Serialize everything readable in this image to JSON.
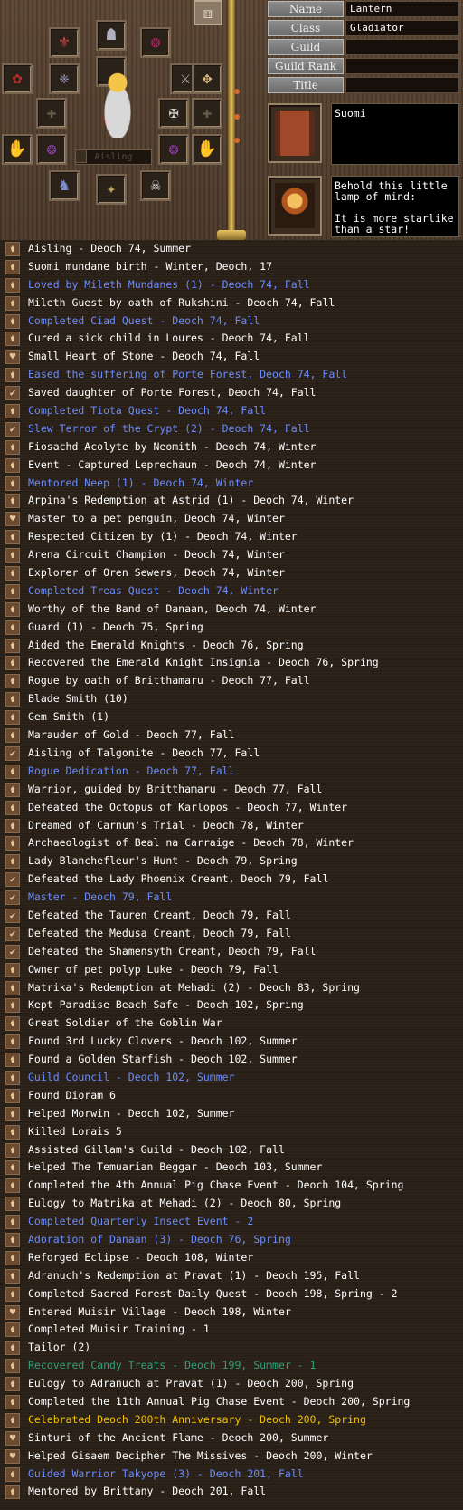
{
  "profile": {
    "fields": [
      {
        "label": "Name",
        "value": "Lantern"
      },
      {
        "label": "Class",
        "value": "Gladiator"
      },
      {
        "label": "Guild",
        "value": ""
      },
      {
        "label": "Guild Rank",
        "value": ""
      },
      {
        "label": "Title",
        "value": ""
      }
    ],
    "name_tag": "Aisling",
    "legend_item_1": {
      "text": "Suomi"
    },
    "legend_item_2": {
      "text": "Behold this little\nlamp of mind:\n\nIt is more starlike\nthan a star!"
    }
  },
  "equipment_slots": [
    {
      "name": "amulet-slot",
      "icon": "pendant-icon",
      "glyph": "⚜"
    },
    {
      "name": "helmet-slot",
      "icon": "helmet-icon",
      "glyph": "☗"
    },
    {
      "name": "ring-left-slot",
      "icon": "ring-icon",
      "glyph": "❂"
    },
    {
      "name": "rose-slot",
      "icon": "rose-icon",
      "glyph": "✿"
    },
    {
      "name": "wings-left-slot",
      "icon": "wings-icon",
      "glyph": "❈"
    },
    {
      "name": "weapon-slot",
      "icon": "sword-icon",
      "glyph": "⚔"
    },
    {
      "name": "angel-slot",
      "icon": "angel-icon",
      "glyph": "✥"
    },
    {
      "name": "empty-slot-1",
      "icon": "cross-icon",
      "glyph": "✚"
    },
    {
      "name": "armor-slot",
      "icon": "armor-icon",
      "glyph": "✠"
    },
    {
      "name": "empty-slot-2",
      "icon": "cross-icon",
      "glyph": "✚"
    },
    {
      "name": "gauntlet-left-slot",
      "icon": "gauntlet-icon",
      "glyph": "✋"
    },
    {
      "name": "earring-left-slot",
      "icon": "earring-icon",
      "glyph": "❂"
    },
    {
      "name": "earring-right-slot",
      "icon": "earring-icon",
      "glyph": "❂"
    },
    {
      "name": "gauntlet-right-slot",
      "icon": "gauntlet-icon",
      "glyph": "✋"
    },
    {
      "name": "boots-slot",
      "icon": "boots-icon",
      "glyph": "♞"
    },
    {
      "name": "belt-slot",
      "icon": "belt-icon",
      "glyph": "✦"
    },
    {
      "name": "accessory-slot",
      "icon": "skull-staff-icon",
      "glyph": "☠"
    },
    {
      "name": "shield-slot",
      "icon": "empty-icon",
      "glyph": ""
    }
  ],
  "top_right_button": {
    "icon": "dice-icon",
    "glyph": "⚃"
  },
  "colors": {
    "white": "#ffffff",
    "blue": "#6a8cff",
    "green": "#2fa07a",
    "yellow": "#f0c000"
  },
  "legend": [
    {
      "text": "Aisling - Deoch 74, Summer",
      "color": "white",
      "mark": "lantern-mark-icon"
    },
    {
      "text": "Suomi mundane birth - Winter, Deoch, 17",
      "color": "white",
      "mark": "lantern-mark-icon"
    },
    {
      "text": "Loved by Mileth Mundanes (1) - Deoch 74, Fall",
      "color": "blue",
      "mark": "lantern-mark-icon"
    },
    {
      "text": "Mileth Guest by oath of Rukshini - Deoch 74, Fall",
      "color": "white",
      "mark": "lantern-mark-icon"
    },
    {
      "text": "Completed Ciad Quest - Deoch 74, Fall",
      "color": "blue",
      "mark": "lantern-mark-icon"
    },
    {
      "text": "Cured a sick child in Loures - Deoch 74, Fall",
      "color": "white",
      "mark": "lantern-mark-icon"
    },
    {
      "text": "Small Heart of Stone - Deoch 74, Fall",
      "color": "white",
      "mark": "heart-mark-icon"
    },
    {
      "text": "Eased the suffering of Porte Forest, Deoch 74, Fall",
      "color": "blue",
      "mark": "lantern-mark-icon"
    },
    {
      "text": "Saved daughter of Porte Forest, Deoch 74, Fall",
      "color": "white",
      "mark": "check-mark-icon"
    },
    {
      "text": "Completed Tiota Quest - Deoch 74, Fall",
      "color": "blue",
      "mark": "lantern-mark-icon"
    },
    {
      "text": "Slew Terror of the Crypt (2) - Deoch 74, Fall",
      "color": "blue",
      "mark": "check-mark-icon"
    },
    {
      "text": "Fiosachd Acolyte by Neomith - Deoch 74, Winter",
      "color": "white",
      "mark": "lantern-mark-icon"
    },
    {
      "text": "Event - Captured Leprechaun - Deoch 74, Winter",
      "color": "white",
      "mark": "lantern-mark-icon"
    },
    {
      "text": "Mentored Neep (1) - Deoch 74, Winter",
      "color": "blue",
      "mark": "lantern-mark-icon"
    },
    {
      "text": "Arpina's Redemption at Astrid (1) - Deoch 74, Winter",
      "color": "white",
      "mark": "lantern-mark-icon"
    },
    {
      "text": "Master to a pet penguin, Deoch 74, Winter",
      "color": "white",
      "mark": "heart-mark-icon"
    },
    {
      "text": "Respected Citizen by  (1) - Deoch 74, Winter",
      "color": "white",
      "mark": "lantern-mark-icon"
    },
    {
      "text": "Arena Circuit Champion - Deoch 74, Winter",
      "color": "white",
      "mark": "lantern-mark-icon"
    },
    {
      "text": "Explorer of Oren Sewers, Deoch 74, Winter",
      "color": "white",
      "mark": "lantern-mark-icon"
    },
    {
      "text": "Completed Treas Quest - Deoch 74, Winter",
      "color": "blue",
      "mark": "lantern-mark-icon"
    },
    {
      "text": "Worthy of the Band of Danaan, Deoch 74, Winter",
      "color": "white",
      "mark": "lantern-mark-icon"
    },
    {
      "text": "Guard (1) - Deoch 75, Spring",
      "color": "white",
      "mark": "lantern-mark-icon"
    },
    {
      "text": "Aided the Emerald Knights - Deoch 76, Spring",
      "color": "white",
      "mark": "lantern-mark-icon"
    },
    {
      "text": "Recovered the Emerald Knight Insignia - Deoch 76, Spring",
      "color": "white",
      "mark": "lantern-mark-icon"
    },
    {
      "text": "Rogue by oath of Britthamaru - Deoch 77, Fall",
      "color": "white",
      "mark": "lantern-mark-icon"
    },
    {
      "text": "Blade Smith (10)",
      "color": "white",
      "mark": "lantern-mark-icon"
    },
    {
      "text": "Gem Smith (1)",
      "color": "white",
      "mark": "lantern-mark-icon"
    },
    {
      "text": "Marauder of Gold - Deoch 77, Fall",
      "color": "white",
      "mark": "lantern-mark-icon"
    },
    {
      "text": "Aisling of Talgonite - Deoch 77, Fall",
      "color": "white",
      "mark": "check-mark-icon"
    },
    {
      "text": "Rogue Dedication - Deoch 77, Fall",
      "color": "blue",
      "mark": "lantern-mark-icon"
    },
    {
      "text": "Warrior, guided by Britthamaru - Deoch 77, Fall",
      "color": "white",
      "mark": "lantern-mark-icon"
    },
    {
      "text": "Defeated the Octopus of Karlopos - Deoch 77, Winter",
      "color": "white",
      "mark": "lantern-mark-icon"
    },
    {
      "text": "Dreamed of Carnun's Trial - Deoch 78, Winter",
      "color": "white",
      "mark": "lantern-mark-icon"
    },
    {
      "text": "Archaeologist of Beal na Carraige - Deoch 78, Winter",
      "color": "white",
      "mark": "lantern-mark-icon"
    },
    {
      "text": "Lady Blanchefleur's Hunt - Deoch 79, Spring",
      "color": "white",
      "mark": "lantern-mark-icon"
    },
    {
      "text": "Defeated the Lady Phoenix Creant, Deoch 79, Fall",
      "color": "white",
      "mark": "check-mark-icon"
    },
    {
      "text": "Master - Deoch 79, Fall",
      "color": "blue",
      "mark": "check-mark-icon"
    },
    {
      "text": "Defeated the Tauren Creant, Deoch 79, Fall",
      "color": "white",
      "mark": "check-mark-icon"
    },
    {
      "text": "Defeated the Medusa Creant, Deoch 79, Fall",
      "color": "white",
      "mark": "check-mark-icon"
    },
    {
      "text": "Defeated the Shamensyth Creant, Deoch 79, Fall",
      "color": "white",
      "mark": "check-mark-icon"
    },
    {
      "text": "Owner of pet polyp Luke - Deoch 79, Fall",
      "color": "white",
      "mark": "lantern-mark-icon"
    },
    {
      "text": "Matrika's Redemption at Mehadi (2) - Deoch 83, Spring",
      "color": "white",
      "mark": "lantern-mark-icon"
    },
    {
      "text": "Kept Paradise Beach Safe - Deoch 102, Spring",
      "color": "white",
      "mark": "lantern-mark-icon"
    },
    {
      "text": "Great Soldier of the Goblin War",
      "color": "white",
      "mark": "lantern-mark-icon"
    },
    {
      "text": "Found 3rd Lucky Clovers - Deoch 102, Summer",
      "color": "white",
      "mark": "lantern-mark-icon"
    },
    {
      "text": "Found a Golden Starfish - Deoch 102, Summer",
      "color": "white",
      "mark": "lantern-mark-icon"
    },
    {
      "text": "Guild Council - Deoch 102, Summer",
      "color": "blue",
      "mark": "lantern-mark-icon"
    },
    {
      "text": "Found Dioram 6",
      "color": "white",
      "mark": "lantern-mark-icon"
    },
    {
      "text": "Helped Morwin - Deoch 102, Summer",
      "color": "white",
      "mark": "lantern-mark-icon"
    },
    {
      "text": "Killed Lorais 5",
      "color": "white",
      "mark": "lantern-mark-icon"
    },
    {
      "text": "Assisted Gillam's Guild - Deoch 102, Fall",
      "color": "white",
      "mark": "lantern-mark-icon"
    },
    {
      "text": "Helped The Temuarian Beggar - Deoch 103, Summer",
      "color": "white",
      "mark": "lantern-mark-icon"
    },
    {
      "text": "Completed the 4th Annual Pig Chase Event - Deoch 104, Spring",
      "color": "white",
      "mark": "lantern-mark-icon"
    },
    {
      "text": "Eulogy to Matrika at Mehadi (2) - Deoch 80, Spring",
      "color": "white",
      "mark": "lantern-mark-icon"
    },
    {
      "text": "Completed Quarterly Insect Event - 2",
      "color": "blue",
      "mark": "lantern-mark-icon"
    },
    {
      "text": "Adoration of Danaan (3) - Deoch 76, Spring",
      "color": "blue",
      "mark": "lantern-mark-icon"
    },
    {
      "text": "Reforged Eclipse - Deoch 108, Winter",
      "color": "white",
      "mark": "lantern-mark-icon"
    },
    {
      "text": "Adranuch's Redemption at Pravat (1) - Deoch 195, Fall",
      "color": "white",
      "mark": "lantern-mark-icon"
    },
    {
      "text": "Completed Sacred Forest Daily Quest - Deoch 198, Spring - 2",
      "color": "white",
      "mark": "lantern-mark-icon"
    },
    {
      "text": "Entered Muisir Village - Deoch 198, Winter",
      "color": "white",
      "mark": "heart-mark-icon"
    },
    {
      "text": "Completed Muisir Training - 1",
      "color": "white",
      "mark": "lantern-mark-icon"
    },
    {
      "text": "Tailor (2)",
      "color": "white",
      "mark": "lantern-mark-icon"
    },
    {
      "text": "Recovered Candy Treats - Deoch 199, Summer - 1",
      "color": "green",
      "mark": "lantern-mark-icon"
    },
    {
      "text": "Eulogy to Adranuch at Pravat (1) - Deoch 200, Spring",
      "color": "white",
      "mark": "lantern-mark-icon"
    },
    {
      "text": "Completed the 11th Annual Pig Chase Event - Deoch 200, Spring",
      "color": "white",
      "mark": "lantern-mark-icon"
    },
    {
      "text": "Celebrated Deoch 200th Anniversary - Deoch 200, Spring",
      "color": "yellow",
      "mark": "lantern-mark-icon"
    },
    {
      "text": "Sinturi of the Ancient Flame - Deoch 200, Summer",
      "color": "white",
      "mark": "heart-mark-icon"
    },
    {
      "text": "Helped Gisaem Decipher The Missives - Deoch 200, Winter",
      "color": "white",
      "mark": "heart-mark-icon"
    },
    {
      "text": "Guided Warrior Takyope (3) - Deoch 201, Fall",
      "color": "blue",
      "mark": "lantern-mark-icon"
    },
    {
      "text": "Mentored by Brittany - Deoch 201, Fall",
      "color": "white",
      "mark": "lantern-mark-icon"
    }
  ]
}
